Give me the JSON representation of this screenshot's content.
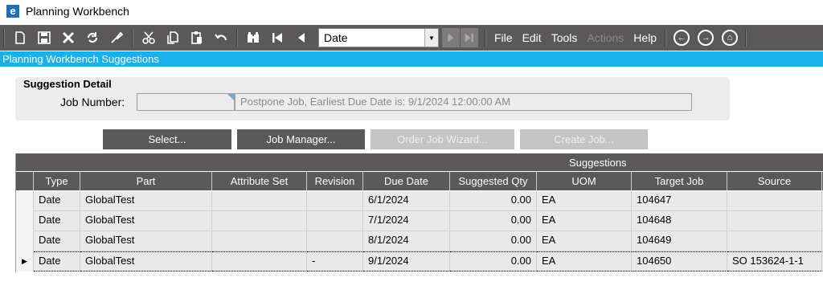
{
  "window": {
    "title": "Planning Workbench",
    "app_icon": "e"
  },
  "toolbar": {
    "icons": [
      "new-icon",
      "save-icon",
      "delete-icon",
      "refresh-icon",
      "clear-icon",
      "cut-icon",
      "copy-icon",
      "paste-icon",
      "undo-icon",
      "search-icon",
      "first-record-icon",
      "previous-record-icon"
    ],
    "nav_combo_value": "Date",
    "menus": {
      "file": "File",
      "edit": "Edit",
      "tools": "Tools",
      "actions": "Actions",
      "help": "Help"
    },
    "colors": {
      "background": "#5a5858"
    }
  },
  "header": {
    "title": "Planning Workbench Suggestions",
    "color": "#1ab0ea"
  },
  "detail": {
    "title": "Suggestion Detail",
    "job_number_label": "Job Number:",
    "job_number_value": "",
    "description": "Postpone Job, Earliest Due Date is: 9/1/2024 12:00:00 AM"
  },
  "buttons": {
    "select": "Select...",
    "job_manager": "Job Manager...",
    "order_job_wizard": "Order Job Wizard...",
    "create_job": "Create Job..."
  },
  "grid": {
    "banner": "Suggestions",
    "columns": [
      "Type",
      "Part",
      "Attribute Set",
      "Revision",
      "Due Date",
      "Suggested Qty",
      "UOM",
      "Target Job",
      "Source"
    ],
    "rows": [
      {
        "type": "Date",
        "part": "GlobalTest",
        "attribute_set": "",
        "revision": "",
        "due_date": "6/1/2024",
        "qty": "0.00",
        "uom": "EA",
        "target_job": "104647",
        "source": ""
      },
      {
        "type": "Date",
        "part": "GlobalTest",
        "attribute_set": "",
        "revision": "",
        "due_date": "7/1/2024",
        "qty": "0.00",
        "uom": "EA",
        "target_job": "104648",
        "source": ""
      },
      {
        "type": "Date",
        "part": "GlobalTest",
        "attribute_set": "",
        "revision": "",
        "due_date": "8/1/2024",
        "qty": "0.00",
        "uom": "EA",
        "target_job": "104649",
        "source": ""
      },
      {
        "type": "Date",
        "part": "GlobalTest",
        "attribute_set": "",
        "revision": "-",
        "due_date": "9/1/2024",
        "qty": "0.00",
        "uom": "EA",
        "target_job": "104650",
        "source": "SO 153624-1-1"
      }
    ],
    "active_row_indicator": "▶"
  }
}
